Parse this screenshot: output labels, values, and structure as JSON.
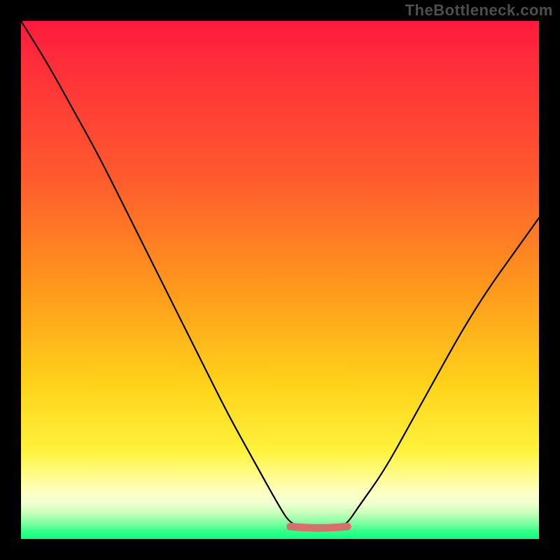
{
  "watermark": "TheBottleneck.com",
  "chart_data": {
    "type": "line",
    "title": "",
    "xlabel": "",
    "ylabel": "",
    "xlim": [
      0,
      100
    ],
    "ylim": [
      0,
      100
    ],
    "series": [
      {
        "name": "primary-curve",
        "x": [
          0,
          5,
          10,
          15,
          20,
          25,
          30,
          35,
          40,
          45,
          50,
          52,
          55,
          58,
          61,
          63,
          65,
          70,
          75,
          80,
          85,
          90,
          95,
          100
        ],
        "values": [
          100,
          92,
          83,
          74,
          64,
          54,
          44,
          34,
          24,
          15,
          6,
          3,
          2,
          2,
          2,
          3,
          6,
          13,
          22,
          31,
          40,
          48,
          55,
          62
        ]
      }
    ],
    "annotations": [
      {
        "name": "valley-marker",
        "type": "segment",
        "x_start": 52,
        "x_end": 63,
        "y": 2
      }
    ],
    "colors": {
      "curve": "#000000",
      "valley_marker": "#d6706c",
      "gradient_top": "#ff1a3e",
      "gradient_mid": "#ffd21a",
      "gradient_bottom": "#0cff82"
    }
  }
}
